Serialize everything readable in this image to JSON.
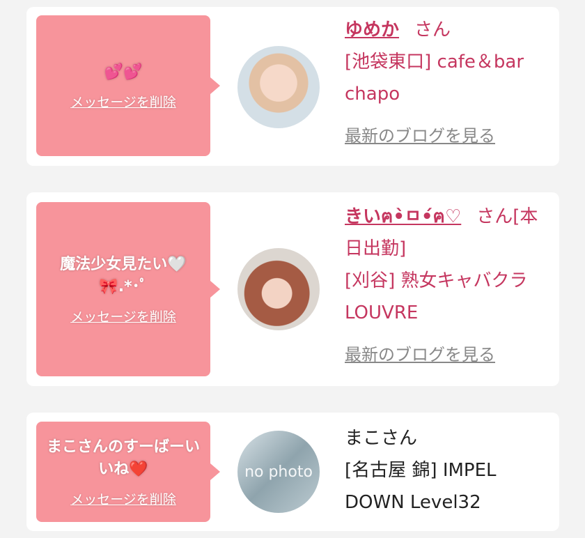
{
  "delete_label": "メッセージを削除",
  "blog_label": "最新のブログを見る",
  "entries": [
    {
      "message": "💕💕",
      "name": "ゆめか",
      "suffix": "さん",
      "shop": "[池袋東口] cafe＆bar chapo"
    },
    {
      "message": "魔法少女見たい🤍🎀.*･ﾟ",
      "name": "きいฅ•̀ㅁ•́ฅ♡",
      "suffix": "さん[本日出勤]",
      "shop": "[刈谷] 熟女キャバクラ LOUVRE"
    },
    {
      "message": "まこさんのすーばーいいね❤️",
      "name": "まこさん",
      "suffix": "",
      "shop": "[名古屋 錦] IMPEL DOWN Level32",
      "avatar_text": "no photo"
    }
  ],
  "colors": {
    "bubble": "#f7949b",
    "accent": "#c5365f",
    "link_gray": "#888888",
    "background": "#f3f3f3"
  }
}
